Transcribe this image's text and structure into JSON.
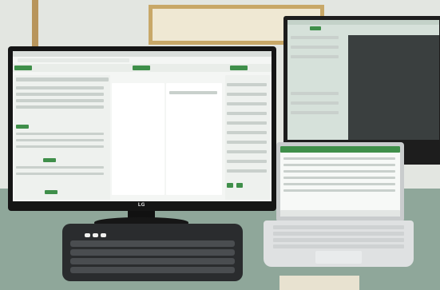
{
  "monitor": {
    "brand_logo": "LG"
  },
  "colors": {
    "wall": "#e3e6e1",
    "desk": "#8fa79a",
    "monitor_bezel": "#151515",
    "screen_bg": "#f4f6f4",
    "ui_green": "#3f8f4a",
    "side_panel": "#d6e1da",
    "side_dark": "#3a3f3f",
    "laptop": "#c9cccd",
    "keyboard": "#2a2c2e"
  },
  "icons": [
    "monitor-stand-icon",
    "laptop-icon",
    "keyboard-icon",
    "picture-frame-icon"
  ]
}
